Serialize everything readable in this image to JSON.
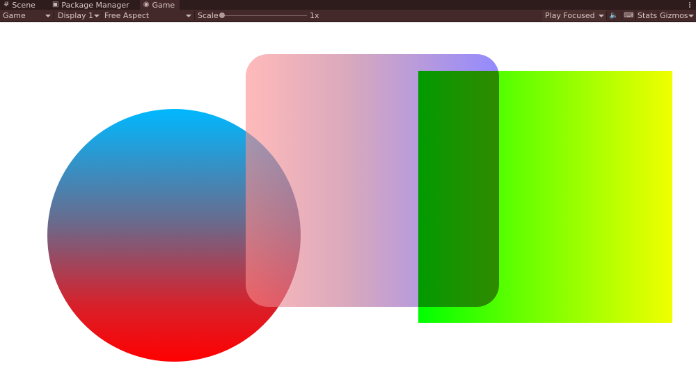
{
  "tabs": [
    {
      "label": "Scene",
      "icon": "grid-icon"
    },
    {
      "label": "Package Manager",
      "icon": "package-icon"
    },
    {
      "label": "Game",
      "icon": "gamepad-icon"
    }
  ],
  "toolbar": {
    "view_select": "Game",
    "display_select": "Display 1",
    "aspect_select": "Free Aspect",
    "scale_label": "Scale",
    "scale_value": "1x",
    "play_mode_select": "Play Focused",
    "stats_label": "Stats",
    "gizmos_label": "Gizmos"
  },
  "scene": {
    "shapes": [
      {
        "shape": "circle",
        "gradient": [
          "#00b8ff",
          "#ff0000"
        ],
        "direction": "vertical"
      },
      {
        "shape": "rounded-rectangle",
        "gradient": [
          "#ff8c8c",
          "#4b3cff"
        ],
        "direction": "horizontal",
        "opacity": 0.6
      },
      {
        "shape": "square",
        "gradient": [
          "#00ff00",
          "#f0ff00"
        ],
        "direction": "horizontal"
      }
    ]
  },
  "colors": {
    "editor_bg": "#3a2424",
    "toolbar_bg": "#432929",
    "text": "#d8c4c4",
    "viewport_bg": "#ffffff"
  }
}
